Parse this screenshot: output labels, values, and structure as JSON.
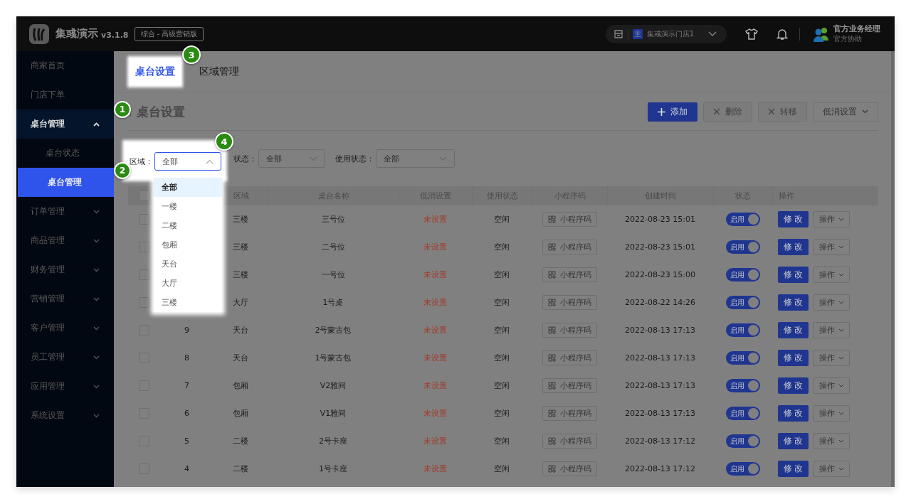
{
  "header": {
    "app_name": "集彧演示",
    "version": "v3.1.8",
    "edition": "综合 - 高级营销版",
    "store_tag": "主",
    "store": "集彧演示门店1",
    "user_name": "官方业务经理",
    "user_role": "官方协助"
  },
  "sidebar": {
    "items": [
      {
        "label": "商家首页",
        "kind": "link"
      },
      {
        "label": "门店下单",
        "kind": "link"
      },
      {
        "label": "桌台管理",
        "kind": "group",
        "expanded": true,
        "callout": "1",
        "children": [
          {
            "label": "桌台状态",
            "selected": false
          },
          {
            "label": "桌台管理",
            "selected": true,
            "callout": "2"
          }
        ]
      },
      {
        "label": "订单管理",
        "kind": "group",
        "expanded": false
      },
      {
        "label": "商品管理",
        "kind": "group",
        "expanded": false
      },
      {
        "label": "财务管理",
        "kind": "group",
        "expanded": false
      },
      {
        "label": "营销管理",
        "kind": "group",
        "expanded": false
      },
      {
        "label": "客户管理",
        "kind": "group",
        "expanded": false
      },
      {
        "label": "员工管理",
        "kind": "group",
        "expanded": false
      },
      {
        "label": "应用管理",
        "kind": "group",
        "expanded": false
      },
      {
        "label": "系统设置",
        "kind": "group",
        "expanded": false
      }
    ]
  },
  "tabs": [
    {
      "label": "桌台设置",
      "selected": true,
      "callout": "3"
    },
    {
      "label": "区域管理",
      "selected": false
    }
  ],
  "page_title": "桌台设置",
  "toolbar": [
    {
      "label": "添加",
      "kind": "add",
      "disabled": false
    },
    {
      "label": "删除",
      "kind": "remove",
      "disabled": true
    },
    {
      "label": "转移",
      "kind": "remove",
      "disabled": true
    },
    {
      "label": "低消设置",
      "kind": "dropdown",
      "disabled": false
    }
  ],
  "filters": [
    {
      "label": "区域：",
      "value": "全部",
      "open": true,
      "callout": "4",
      "options": [
        {
          "label": "全部",
          "selected": true
        },
        {
          "label": "一楼",
          "selected": false
        },
        {
          "label": "二楼",
          "selected": false
        },
        {
          "label": "包厢",
          "selected": false
        },
        {
          "label": "天台",
          "selected": false
        },
        {
          "label": "大厅",
          "selected": false
        },
        {
          "label": "三楼",
          "selected": false
        }
      ]
    },
    {
      "label": "状态：",
      "value": "全部",
      "open": false
    },
    {
      "label": "使用状态：",
      "value": "全部",
      "open": false
    }
  ],
  "table": {
    "all_checked": false,
    "columns": [
      "区域",
      "桌台名称",
      "低消设置",
      "使用状态",
      "小程序码",
      "创建时间",
      "状态",
      "操作"
    ],
    "rows": [
      {
        "checked": false,
        "area": "三楼",
        "name": "三号位",
        "min_spend": "未设置",
        "usage": "空闲",
        "qr": "小程序码",
        "created": "2022-08-23 15:01",
        "status": "启用",
        "on": true,
        "edit": "修改",
        "more": "操作"
      },
      {
        "checked": false,
        "area": "三楼",
        "name": "二号位",
        "min_spend": "未设置",
        "usage": "空闲",
        "qr": "小程序码",
        "created": "2022-08-23 15:01",
        "status": "启用",
        "on": true,
        "edit": "修改",
        "more": "操作"
      },
      {
        "checked": false,
        "area": "三楼",
        "name": "一号位",
        "min_spend": "未设置",
        "usage": "空闲",
        "qr": "小程序码",
        "created": "2022-08-23 15:00",
        "status": "启用",
        "on": true,
        "edit": "修改",
        "more": "操作"
      },
      {
        "checked": false,
        "area": "大厅",
        "name": "1号桌",
        "min_spend": "未设置",
        "usage": "空闲",
        "qr": "小程序码",
        "created": "2022-08-22 14:26",
        "status": "启用",
        "on": true,
        "edit": "修改",
        "more": "操作"
      },
      {
        "checked": false,
        "no": "9",
        "area": "天台",
        "name": "2号蒙古包",
        "min_spend": "未设置",
        "usage": "空闲",
        "qr": "小程序码",
        "created": "2022-08-13 17:13",
        "status": "启用",
        "on": true,
        "edit": "修改",
        "more": "操作"
      },
      {
        "checked": false,
        "no": "8",
        "area": "天台",
        "name": "1号蒙古包",
        "min_spend": "未设置",
        "usage": "空闲",
        "qr": "小程序码",
        "created": "2022-08-13 17:13",
        "status": "启用",
        "on": true,
        "edit": "修改",
        "more": "操作"
      },
      {
        "checked": false,
        "no": "7",
        "area": "包厢",
        "name": "V2雅间",
        "min_spend": "未设置",
        "usage": "空闲",
        "qr": "小程序码",
        "created": "2022-08-13 17:13",
        "status": "启用",
        "on": true,
        "edit": "修改",
        "more": "操作"
      },
      {
        "checked": false,
        "no": "6",
        "area": "包厢",
        "name": "V1雅间",
        "min_spend": "未设置",
        "usage": "空闲",
        "qr": "小程序码",
        "created": "2022-08-13 17:13",
        "status": "启用",
        "on": true,
        "edit": "修改",
        "more": "操作"
      },
      {
        "checked": false,
        "no": "5",
        "area": "二楼",
        "name": "2号卡座",
        "min_spend": "未设置",
        "usage": "空闲",
        "qr": "小程序码",
        "created": "2022-08-13 17:12",
        "status": "启用",
        "on": true,
        "edit": "修改",
        "more": "操作"
      },
      {
        "checked": false,
        "no": "4",
        "area": "二楼",
        "name": "1号卡座",
        "min_spend": "未设置",
        "usage": "空闲",
        "qr": "小程序码",
        "created": "2022-08-13 17:12",
        "status": "启用",
        "on": true,
        "edit": "修改",
        "more": "操作"
      }
    ]
  }
}
